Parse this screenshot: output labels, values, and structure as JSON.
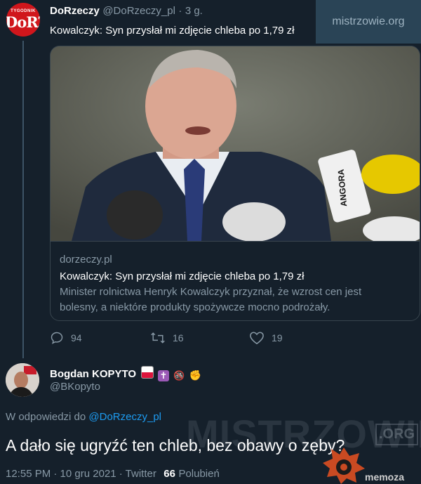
{
  "watermark": "mistrzowie.org",
  "tweet1": {
    "avatar_top_text": "TYGODNIK",
    "avatar_logo_text": "DoRZEC",
    "name": "DoRzeczy",
    "handle": "@DoRzeczy_pl",
    "separator": "·",
    "time": "3 g.",
    "text": "Kowalczyk: Syn przysłał mi zdjęcie chleba po 1,79 zł",
    "card": {
      "domain": "dorzeczy.pl",
      "title": "Kowalczyk: Syn przysłał mi zdjęcie chleba po 1,79 zł",
      "description_line1": "Minister rolnictwa Henryk Kowalczyk przyznał, że wzrost cen jest",
      "description_line2": "bolesny, a niektóre produkty spożywcze mocno podrożały.",
      "mic_label": "ANGORA"
    },
    "actions": {
      "replies": "94",
      "retweets": "16",
      "likes": "19"
    }
  },
  "tweet2": {
    "name": "Bogdan KOPYTO",
    "handle": "@BKopyto",
    "reply_prefix": "W odpowiedzi do",
    "reply_to": "@DoRzeczy_pl",
    "text": "A dało się ugryźć ten chleb, bez obawy o zęby?",
    "timestamp": "12:55 PM · 10 gru 2021 · Twitter",
    "likes_count": "66",
    "likes_label": "Polubień"
  },
  "overlay": {
    "big": "MISTRZOWIE",
    "org": ".ORG",
    "memoza": "memoza"
  },
  "colors": {
    "background": "#15202b",
    "link": "#1d9bf0",
    "muted": "#8899a6",
    "border": "#38444d"
  }
}
